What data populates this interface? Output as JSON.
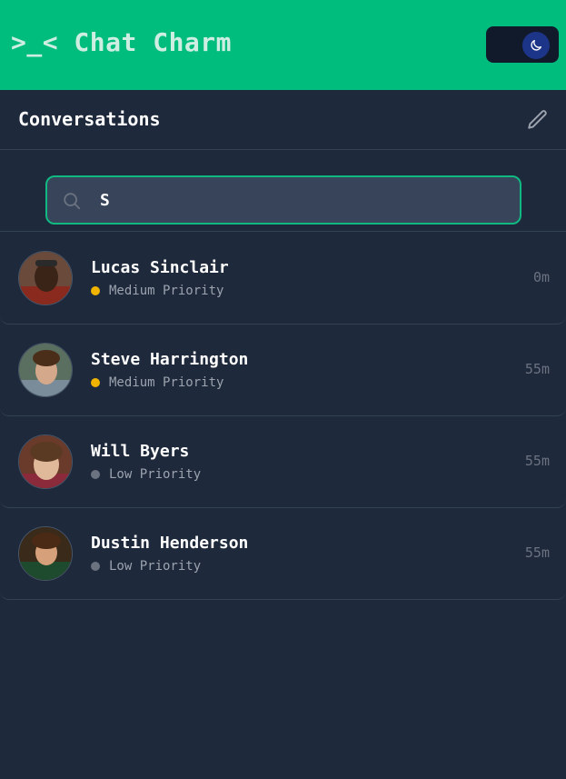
{
  "app": {
    "title": ">_< Chat Charm"
  },
  "theme_toggle": {
    "icon": "moon-icon"
  },
  "conversations": {
    "title": "Conversations",
    "edit_icon": "pencil-icon"
  },
  "search": {
    "value": "S",
    "placeholder": ""
  },
  "colors": {
    "brand": "#00bd7d",
    "medium_priority": "#f0b400",
    "low_priority": "#6b7280"
  },
  "chats": [
    {
      "name": "Lucas Sinclair",
      "priority": "Medium Priority",
      "priority_level": "medium",
      "time": "0m"
    },
    {
      "name": "Steve Harrington",
      "priority": "Medium Priority",
      "priority_level": "medium",
      "time": "55m"
    },
    {
      "name": "Will Byers",
      "priority": "Low Priority",
      "priority_level": "low",
      "time": "55m"
    },
    {
      "name": "Dustin Henderson",
      "priority": "Low Priority",
      "priority_level": "low",
      "time": "55m"
    }
  ]
}
